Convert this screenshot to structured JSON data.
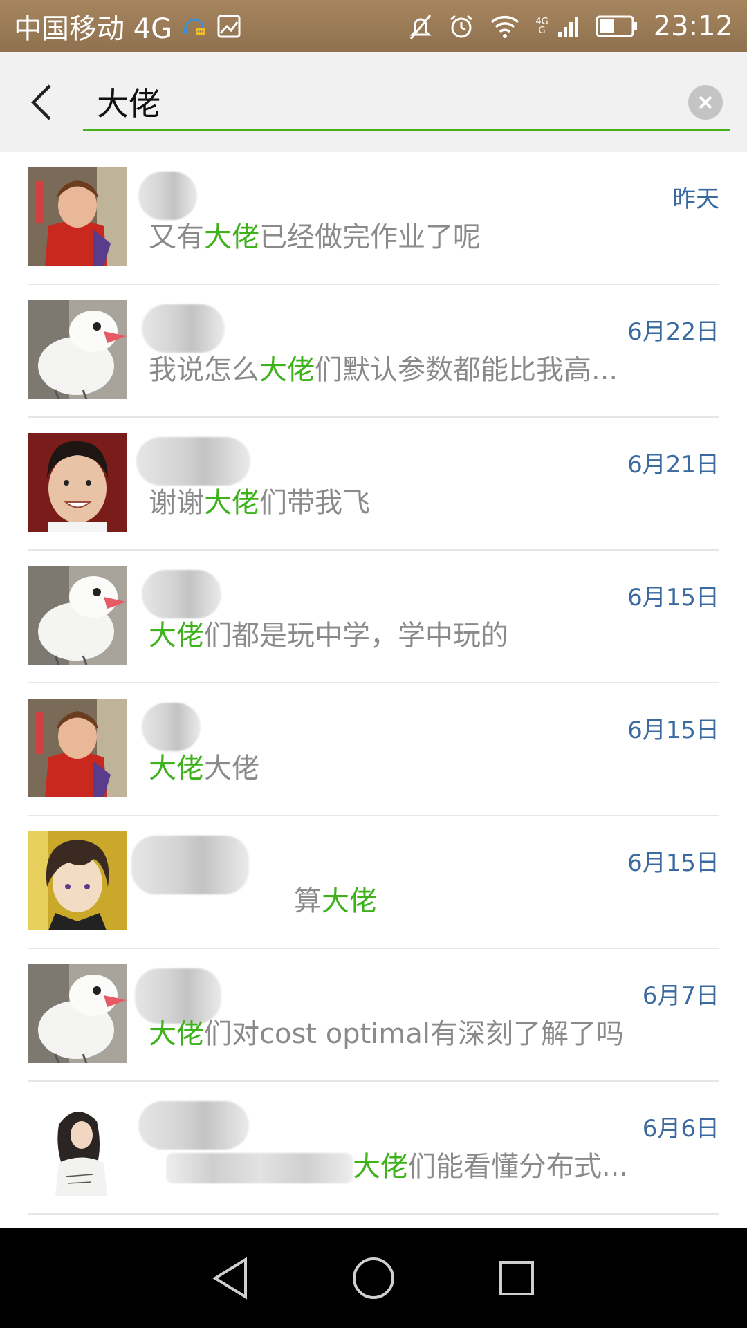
{
  "status_bar": {
    "carrier": "中国移动 4G",
    "network_top": "4G",
    "network_bottom": "G",
    "time": "23:12",
    "icons": [
      "headset-message-icon",
      "image-icon",
      "mute-icon",
      "alarm-icon",
      "wifi-icon",
      "signal-icon",
      "battery-icon"
    ]
  },
  "search": {
    "query": "大佬",
    "placeholder": ""
  },
  "colors": {
    "highlight": "#3db21a",
    "date": "#3a6aa0",
    "status_bar": "#9c7c56",
    "underline": "#45b21c"
  },
  "results": [
    {
      "date": "昨天",
      "pre": "又有",
      "hl": "大佬",
      "post": "已经做完作业了呢",
      "avatar": "crying-girl"
    },
    {
      "date": "6月22日",
      "pre": "我说怎么",
      "hl": "大佬",
      "post": "们默认参数都能比我高...",
      "avatar": "white-bird"
    },
    {
      "date": "6月21日",
      "pre": "谢谢",
      "hl": "大佬",
      "post": "们带我飞",
      "avatar": "smiling-man"
    },
    {
      "date": "6月15日",
      "pre": "",
      "hl": "大佬",
      "post": "们都是玩中学，学中玩的",
      "avatar": "white-bird"
    },
    {
      "date": "6月15日",
      "pre": "",
      "hl": "大佬",
      "post": "大佬",
      "avatar": "crying-girl"
    },
    {
      "date": "6月15日",
      "pre": "算",
      "hl": "大佬",
      "post": "",
      "avatar": "anime-boy"
    },
    {
      "date": "6月7日",
      "pre": "",
      "hl": "大佬",
      "post": "们对cost optimal有深刻了解了吗",
      "avatar": "white-bird"
    },
    {
      "date": "6月6日",
      "pre": "",
      "hl": "大佬",
      "post": "们能看懂分布式...",
      "avatar": "woman-white-shirt"
    }
  ],
  "nav": {
    "buttons": [
      "back-triangle-icon",
      "home-circle-icon",
      "recent-square-icon"
    ]
  }
}
